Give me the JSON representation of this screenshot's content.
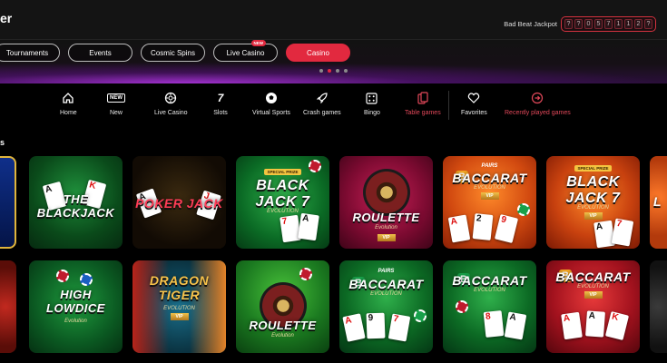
{
  "header": {
    "brand_tail": "er",
    "jackpot_label": "Bad Beat Jackpot",
    "jackpot_digits": [
      "?",
      "?",
      "0",
      "5",
      "7",
      "1",
      "1",
      "2",
      "?"
    ]
  },
  "pills": [
    {
      "label": "Tournaments"
    },
    {
      "label": "Events"
    },
    {
      "label": "Cosmic Spins"
    },
    {
      "label": "Live Casino",
      "badge": "NEW"
    },
    {
      "label": "Casino",
      "active": true
    }
  ],
  "nav": [
    {
      "label": "Home",
      "icon": "home-icon"
    },
    {
      "label": "New",
      "icon": "new-icon",
      "glyph": "NEW"
    },
    {
      "label": "Live Casino",
      "icon": "live-casino-icon"
    },
    {
      "label": "Slots",
      "icon": "slots-icon"
    },
    {
      "label": "Virtual Sports",
      "icon": "soccer-ball-icon"
    },
    {
      "label": "Crash games",
      "icon": "rocket-icon"
    },
    {
      "label": "Bingo",
      "icon": "bingo-icon"
    },
    {
      "label": "Table games",
      "icon": "table-games-icon"
    },
    {
      "label": "Favorites",
      "icon": "heart-icon"
    },
    {
      "label": "Recently played games",
      "icon": "arrow-right-circle-icon"
    }
  ],
  "section_letter": "s",
  "games_row1": [
    {
      "title": "",
      "style": "partial-blue"
    },
    {
      "title": "THE BLACKJACK"
    },
    {
      "title": "POKER JACK"
    },
    {
      "title": "BLACK JACK 7",
      "banner": "SPECIAL PRIZE",
      "sub": "EVOLUTION"
    },
    {
      "title": "ROULETTE",
      "sub": "Evolution",
      "vip": "VIP"
    },
    {
      "title": "BACCARAT",
      "tag": "PAIRS",
      "sub": "EVOLUTION",
      "vip": "VIP"
    },
    {
      "title": "BLACK JACK 7",
      "banner": "SPECIAL PRIZE",
      "sub": "EVOLUTION",
      "vip": "VIP"
    },
    {
      "title": "L"
    }
  ],
  "games_row2": [
    {
      "title": ""
    },
    {
      "title": "HIGH LOWDICE",
      "sub": "Evolution"
    },
    {
      "title": "DRAGON TIGER",
      "sub": "EVOLUTION",
      "vip": "VIP"
    },
    {
      "title": "ROULETTE",
      "sub": "Evolution"
    },
    {
      "title": "BACCARAT",
      "tag": "PAIRS",
      "sub": "EVOLUTION"
    },
    {
      "title": "BACCARAT",
      "sub": "EVOLUTION"
    },
    {
      "title": "BACCARAT",
      "sub": "EVOLUTION",
      "vip": "VIP"
    },
    {
      "title": ""
    }
  ],
  "colors": {
    "accent": "#e2293f",
    "background": "#000000"
  }
}
